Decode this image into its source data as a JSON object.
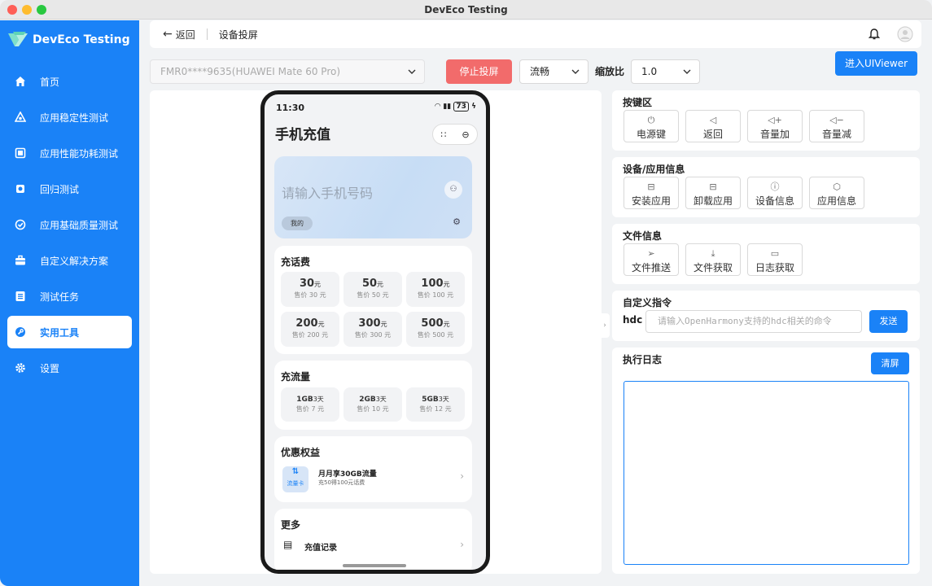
{
  "window": {
    "title": "DevEco Testing"
  },
  "sidebar": {
    "logo": "DevEco Testing",
    "items": [
      {
        "label": "首页",
        "icon": "home-icon"
      },
      {
        "label": "应用稳定性测试",
        "icon": "stability-icon"
      },
      {
        "label": "应用性能功耗测试",
        "icon": "performance-icon"
      },
      {
        "label": "回归测试",
        "icon": "regression-icon"
      },
      {
        "label": "应用基础质量测试",
        "icon": "quality-icon"
      },
      {
        "label": "自定义解决方案",
        "icon": "briefcase-icon"
      },
      {
        "label": "测试任务",
        "icon": "task-list-icon"
      },
      {
        "label": "实用工具",
        "icon": "tools-icon",
        "active": true
      },
      {
        "label": "设置",
        "icon": "gear-icon"
      }
    ]
  },
  "header": {
    "back": "返回",
    "title": "设备投屏"
  },
  "controls": {
    "device": "FMR0****9635(HUAWEI Mate 60 Pro)",
    "stop": "停止投屏",
    "quality": "流畅",
    "zoom_label": "缩放比",
    "zoom": "1.0",
    "uiviewer": "进入UIViewer"
  },
  "phone": {
    "time": "11:30",
    "battery": "73",
    "title": "手机充值",
    "input_placeholder": "请输入手机号码",
    "mine": "我的",
    "recharge": {
      "title": "充话费",
      "options": [
        {
          "amount": "30",
          "unit": "元",
          "price": "售价 30 元"
        },
        {
          "amount": "50",
          "unit": "元",
          "price": "售价 50 元"
        },
        {
          "amount": "100",
          "unit": "元",
          "price": "售价 100 元"
        },
        {
          "amount": "200",
          "unit": "元",
          "price": "售价 200 元"
        },
        {
          "amount": "300",
          "unit": "元",
          "price": "售价 300 元"
        },
        {
          "amount": "500",
          "unit": "元",
          "price": "售价 500 元"
        }
      ]
    },
    "data": {
      "title": "充流量",
      "options": [
        {
          "amount": "1GB",
          "unit": "3天",
          "price": "售价 7 元"
        },
        {
          "amount": "2GB",
          "unit": "3天",
          "price": "售价 10 元"
        },
        {
          "amount": "5GB",
          "unit": "3天",
          "price": "售价 12 元"
        }
      ]
    },
    "benefits": {
      "title": "优惠权益",
      "icon_text": "流量卡",
      "item_title": "月月享30GB流量",
      "item_sub": "充50得100元话费"
    },
    "more": {
      "title": "更多",
      "item": "充值记录"
    }
  },
  "keys": {
    "title": "按键区",
    "buttons": [
      {
        "label": "电源键",
        "icon": "power-icon"
      },
      {
        "label": "返回",
        "icon": "back-triangle-icon"
      },
      {
        "label": "音量加",
        "icon": "volume-up-icon"
      },
      {
        "label": "音量减",
        "icon": "volume-down-icon"
      }
    ]
  },
  "device_info": {
    "title": "设备/应用信息",
    "buttons": [
      {
        "label": "安装应用",
        "icon": "install-icon"
      },
      {
        "label": "卸载应用",
        "icon": "uninstall-icon"
      },
      {
        "label": "设备信息",
        "icon": "info-icon"
      },
      {
        "label": "应用信息",
        "icon": "package-icon"
      }
    ]
  },
  "file_info": {
    "title": "文件信息",
    "buttons": [
      {
        "label": "文件推送",
        "icon": "send-icon"
      },
      {
        "label": "文件获取",
        "icon": "download-icon"
      },
      {
        "label": "日志获取",
        "icon": "folder-icon"
      }
    ]
  },
  "custom_cmd": {
    "title": "自定义指令",
    "prefix": "hdc",
    "placeholder": "请输入OpenHarmony支持的hdc相关的命令",
    "send": "发送"
  },
  "log": {
    "title": "执行日志",
    "clear": "清屏",
    "content": ""
  },
  "colors": {
    "accent": "#1a82f7",
    "danger": "#f26b6b"
  }
}
